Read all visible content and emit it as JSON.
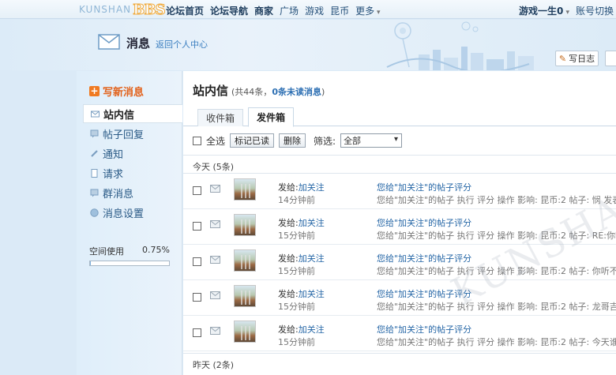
{
  "topbar": {
    "logo_text": "KUNSHAN",
    "logo_mark": "BBS",
    "nav": [
      "论坛首页",
      "论坛导航",
      "商家",
      "广场",
      "游戏",
      "昆币",
      "更多"
    ],
    "user": "游戏一生0",
    "switch_account": "账号切换",
    "exit": "退"
  },
  "header": {
    "title": "消息",
    "back_link": "返回个人中心",
    "write_diary": "写日志"
  },
  "sidebar": {
    "compose": "写新消息",
    "items": [
      {
        "label": "站内信",
        "icon": "envelope-icon"
      },
      {
        "label": "帖子回复",
        "icon": "speech-bubble-icon"
      },
      {
        "label": "通知",
        "icon": "pencil-icon"
      },
      {
        "label": "请求",
        "icon": "document-icon"
      },
      {
        "label": "群消息",
        "icon": "speech-bubble-icon"
      },
      {
        "label": "消息设置",
        "icon": "globe-icon"
      }
    ],
    "space_label": "空间使用",
    "space_percent": "0.75%",
    "space_fraction": 0.0075
  },
  "main": {
    "title": "站内信",
    "count_prefix": "(共44条，",
    "unread": "0条未读消息",
    "count_suffix": ")",
    "tabs": [
      "收件箱",
      "发件箱"
    ],
    "active_tab": "发件箱",
    "select_all": "全选",
    "mark_read": "标记已读",
    "delete": "删除",
    "filter_label": "筛选:",
    "filter_value": "全部",
    "today_label": "今天 (5条)",
    "yesterday_label": "昨天 (2条)",
    "messages": [
      {
        "to_prefix": "发给:",
        "to": "加关注",
        "time": "14分钟前",
        "subject": "您给\"加关注\"的帖子评分",
        "body": "您给\"加关注\"的帖子 执行 评分 操作 影响: 昆币:2 帖子: 悯 发表日期"
      },
      {
        "to_prefix": "发给:",
        "to": "加关注",
        "time": "15分钟前",
        "subject": "您给\"加关注\"的帖子评分",
        "body": "您给\"加关注\"的帖子 执行 评分 操作 影响: 昆币:2 帖子: RE:你听不到"
      },
      {
        "to_prefix": "发给:",
        "to": "加关注",
        "time": "15分钟前",
        "subject": "您给\"加关注\"的帖子评分",
        "body": "您给\"加关注\"的帖子 执行 评分 操作 影响: 昆币:2 帖子: 你听不到吗"
      },
      {
        "to_prefix": "发给:",
        "to": "加关注",
        "time": "15分钟前",
        "subject": "您给\"加关注\"的帖子评分",
        "body": "您给\"加关注\"的帖子 执行 评分 操作 影响: 昆币:2 帖子: 龙哥吉祥，"
      },
      {
        "to_prefix": "发给:",
        "to": "加关注",
        "time": "15分钟前",
        "subject": "您给\"加关注\"的帖子评分",
        "body": "您给\"加关注\"的帖子 执行 评分 操作 影响: 昆币:2 帖子: 今天谁破我"
      }
    ]
  },
  "watermark": "KUNSHAN BBS",
  "colors": {
    "accent": "#2566a6",
    "compose": "#e2611a",
    "background": "#dbeaf7"
  }
}
